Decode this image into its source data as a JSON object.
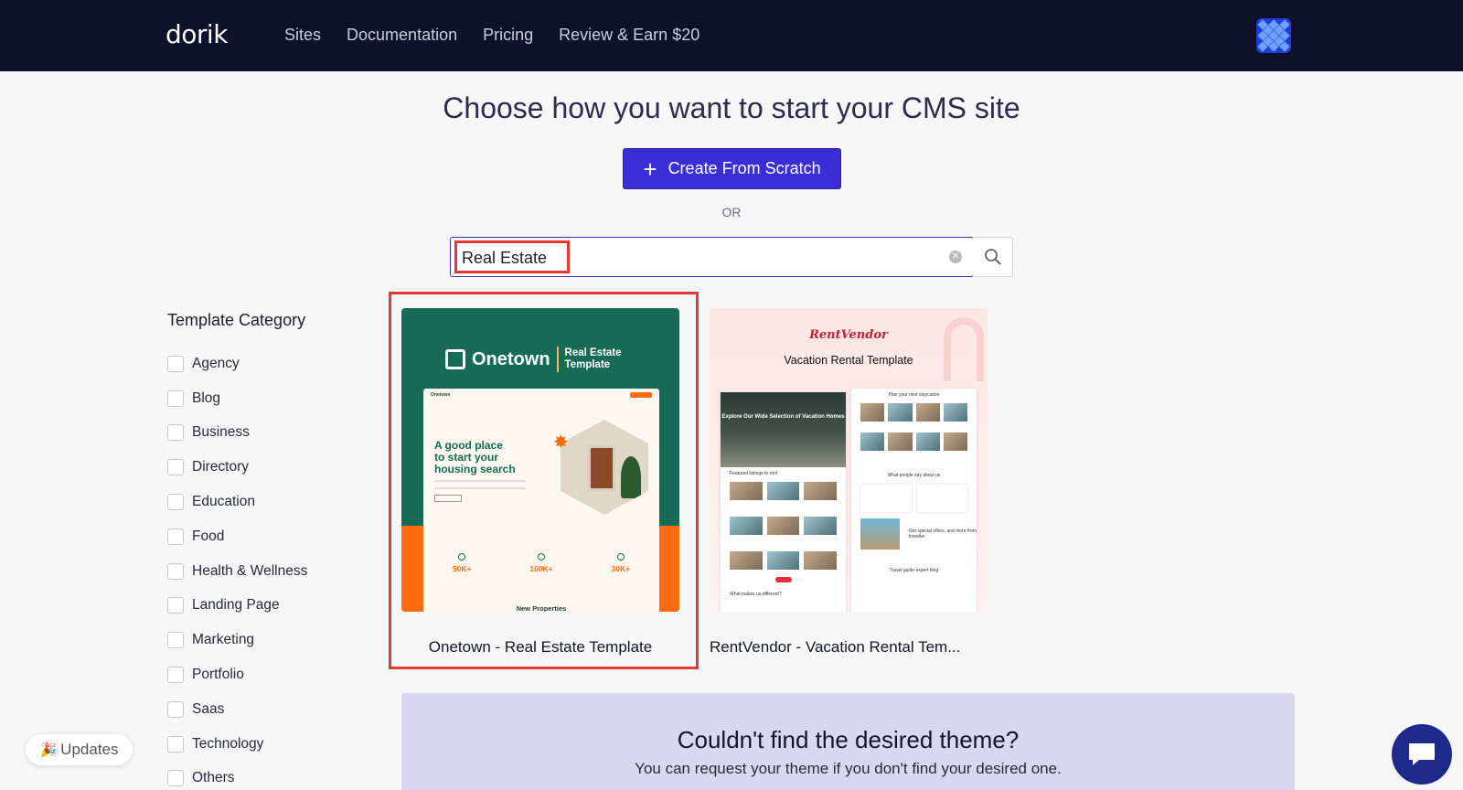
{
  "nav": {
    "logo": "dorik",
    "links": [
      "Sites",
      "Documentation",
      "Pricing",
      "Review & Earn $20"
    ]
  },
  "hero": {
    "title": "Choose how you want to start your CMS site",
    "create_button": "Create From Scratch",
    "or": "OR"
  },
  "search": {
    "value": "Real Estate",
    "clear_icon": "clear-icon",
    "search_icon": "search-icon"
  },
  "sidebar": {
    "title": "Template Category",
    "categories": [
      "Agency",
      "Blog",
      "Business",
      "Directory",
      "Education",
      "Food",
      "Health & Wellness",
      "Landing Page",
      "Marketing",
      "Portfolio",
      "Saas",
      "Technology",
      "Others"
    ]
  },
  "templates": [
    {
      "title": "Onetown - Real Estate Template",
      "preview": {
        "brand": "Onetown",
        "tag_line1": "Real Estate",
        "tag_line2": "Template",
        "nav_brand": "Onetown",
        "headline_1": "A good place",
        "headline_2": "to start your",
        "headline_3": "housing search",
        "stats": [
          "50K+",
          "100K+",
          "30K+"
        ],
        "section": "New Properties"
      }
    },
    {
      "title": "RentVendor - Vacation Rental Tem...",
      "preview": {
        "brand": "RentVendor",
        "subtitle": "Vacation Rental Template",
        "hero_text": "Explore Our Wide Selection of Vacation Homes",
        "featured": "Featured listings to rent",
        "plan": "Plan your next staycation",
        "testimonials": "What people say about us",
        "makes_us": "What makes us different?",
        "offers": "Get special offers, and more from traveller",
        "blog": "Travel guide expert blog"
      }
    }
  ],
  "banner": {
    "title": "Couldn't find the desired theme?",
    "subtitle": "You can request your theme if you don't find your desired one."
  },
  "floating": {
    "updates": "Updates",
    "updates_icon": "party-popper-icon",
    "chat_icon": "chat-icon"
  },
  "colors": {
    "nav_bg": "#0e1129",
    "primary": "#3a2fd6",
    "highlight": "#e53935",
    "banner_bg": "#dad7f2",
    "onetown_green": "#156b53",
    "onetown_orange": "#ff6b10",
    "rentvendor_red": "#c8202f"
  }
}
